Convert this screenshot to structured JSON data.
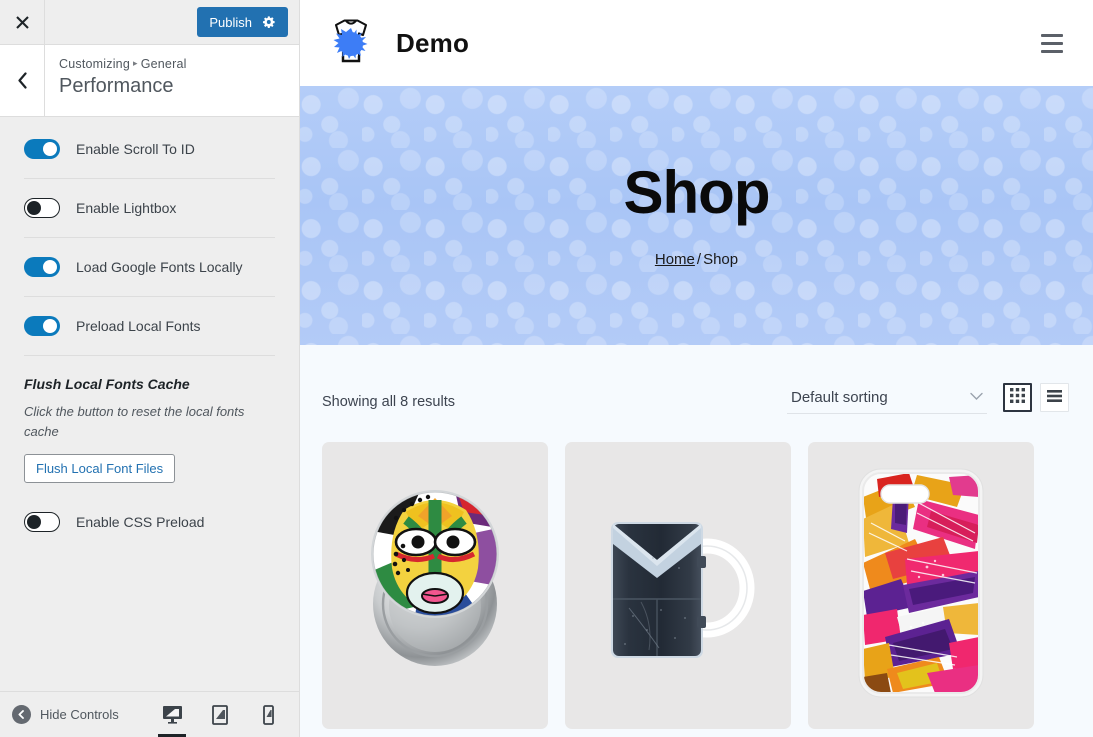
{
  "customizer": {
    "close_icon": "close-icon",
    "publish_label": "Publish",
    "publish_gear_icon": "gear-icon",
    "back_icon": "chevron-left-icon",
    "breadcrumb_root": "Customizing",
    "breadcrumb_separator": "▸",
    "breadcrumb_section": "General",
    "panel_title": "Performance",
    "accent_color": "#2271b1",
    "toggle_on_color": "#0b7abc",
    "settings": [
      {
        "label": "Enable Scroll To ID",
        "state": "on"
      },
      {
        "label": "Enable Lightbox",
        "state": "off"
      },
      {
        "label": "Load Google Fonts Locally",
        "state": "on"
      },
      {
        "label": "Preload Local Fonts",
        "state": "on"
      }
    ],
    "section": {
      "title": "Flush Local Fonts Cache",
      "description": "Click the button to reset the local fonts cache",
      "button_label": "Flush Local Font Files"
    },
    "last_setting": {
      "label": "Enable CSS Preload",
      "state": "off"
    },
    "footer": {
      "hide_controls_label": "Hide Controls",
      "hide_controls_icon": "collapse-left-icon",
      "devices": [
        {
          "name": "desktop",
          "icon": "desktop-icon",
          "active": true
        },
        {
          "name": "tablet",
          "icon": "tablet-icon",
          "active": false
        },
        {
          "name": "mobile",
          "icon": "mobile-icon",
          "active": false
        }
      ]
    }
  },
  "preview": {
    "header": {
      "logo_icon": "tshirt-splatter-logo",
      "site_title": "Demo",
      "menu_icon": "hamburger-menu-icon"
    },
    "hero": {
      "title": "Shop",
      "breadcrumb_home": "Home",
      "breadcrumb_separator": "/",
      "breadcrumb_current": "Shop",
      "background_color": "#a9c5f6"
    },
    "shop_bar": {
      "results_text": "Showing all 8 results",
      "sorting_value": "Default sorting",
      "sorting_caret_icon": "chevron-down-icon",
      "grid_view_icon": "grid-view-icon",
      "list_view_icon": "list-view-icon",
      "grid_view_active": true
    },
    "products": [
      {
        "name": "pin-badge-face-art",
        "image": "colorful-face-pin-button"
      },
      {
        "name": "dark-ceramic-mug",
        "image": "navy-mug-white-handle"
      },
      {
        "name": "abstract-phone-case",
        "image": "colorful-paint-phone-case"
      }
    ]
  }
}
